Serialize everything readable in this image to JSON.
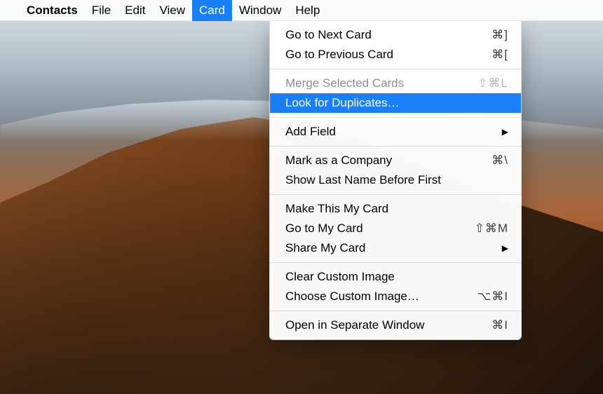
{
  "menubar": {
    "apple_symbol": "",
    "app_name": "Contacts",
    "items": [
      "File",
      "Edit",
      "View",
      "Card",
      "Window",
      "Help"
    ],
    "open_index": 3
  },
  "dropdown": {
    "groups": [
      [
        {
          "label": "Go to Next Card",
          "shortcut": "⌘]",
          "enabled": true
        },
        {
          "label": "Go to Previous Card",
          "shortcut": "⌘[",
          "enabled": true
        }
      ],
      [
        {
          "label": "Merge Selected Cards",
          "shortcut": "⇧⌘L",
          "enabled": false
        },
        {
          "label": "Look for Duplicates…",
          "shortcut": "",
          "enabled": true,
          "highlighted": true
        }
      ],
      [
        {
          "label": "Add Field",
          "submenu": true,
          "enabled": true
        }
      ],
      [
        {
          "label": "Mark as a Company",
          "shortcut": "⌘\\",
          "enabled": true
        },
        {
          "label": "Show Last Name Before First",
          "shortcut": "",
          "enabled": true
        }
      ],
      [
        {
          "label": "Make This My Card",
          "shortcut": "",
          "enabled": true
        },
        {
          "label": "Go to My Card",
          "shortcut": "⇧⌘M",
          "enabled": true
        },
        {
          "label": "Share My Card",
          "submenu": true,
          "enabled": true
        }
      ],
      [
        {
          "label": "Clear Custom Image",
          "shortcut": "",
          "enabled": true
        },
        {
          "label": "Choose Custom Image…",
          "shortcut": "⌥⌘I",
          "enabled": true
        }
      ],
      [
        {
          "label": "Open in Separate Window",
          "shortcut": "⌘I",
          "enabled": true
        }
      ]
    ]
  }
}
